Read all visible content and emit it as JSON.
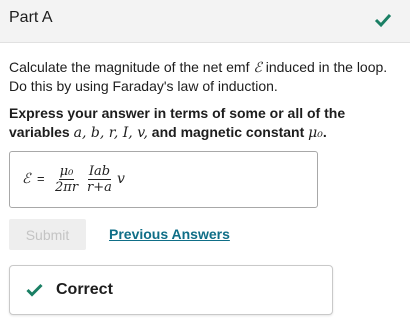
{
  "header": {
    "title": "Part A",
    "status_icon": "checkmark-icon",
    "status_color": "#1a7f64"
  },
  "instructions": {
    "line1_pre": "Calculate the magnitude of the net emf ",
    "line1_symbol": "ℰ",
    "line1_post": " induced in the loop.",
    "line2": "Do this by using Faraday's law of induction."
  },
  "prompt": {
    "part1": "Express your answer in terms of some or all of the",
    "part2_pre": "variables ",
    "vars": "a, b, r, I, v,",
    "part2_mid": " and magnetic constant ",
    "mu": "μ₀",
    "part2_end": "."
  },
  "answer": {
    "lhs": "ℰ",
    "equals": "=",
    "frac1_num": "μ₀",
    "frac1_den": "2πr",
    "frac2_num": "Iab",
    "frac2_den": "r+a",
    "trailing": "v"
  },
  "actions": {
    "submit_label": "Submit",
    "previous_answers_label": "Previous Answers"
  },
  "result": {
    "label": "Correct",
    "icon": "checkmark-icon",
    "color": "#1a7f64"
  }
}
